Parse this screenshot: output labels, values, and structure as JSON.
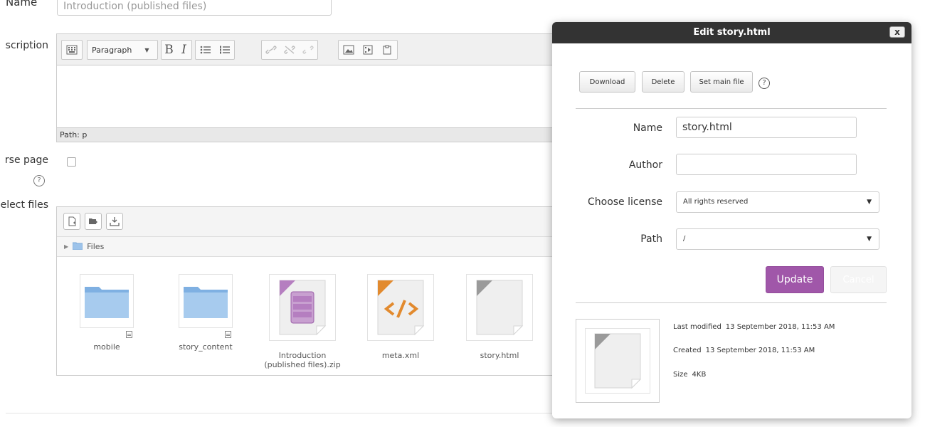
{
  "form": {
    "name_label": "Name",
    "name_value": "Introduction (published files)",
    "description_label": "scription",
    "course_page_label": "rse page",
    "select_files_label": "elect files",
    "help_glyph": "?"
  },
  "editor": {
    "paragraph_label": "Paragraph",
    "bold": "B",
    "italic": "I",
    "path_text": "Path: p"
  },
  "file_manager": {
    "path_label": "Files",
    "items": [
      {
        "label": "mobile",
        "type": "folder"
      },
      {
        "label": "story_content",
        "type": "folder"
      },
      {
        "label": "Introduction (published files).zip",
        "type": "zip"
      },
      {
        "label": "meta.xml",
        "type": "xml"
      },
      {
        "label": "story.html",
        "type": "file"
      }
    ]
  },
  "modal": {
    "title": "Edit story.html",
    "close": "x",
    "buttons": {
      "download": "Download",
      "delete": "Delete",
      "set_main_file": "Set main file",
      "update": "Update",
      "cancel": "Cancel"
    },
    "fields": {
      "name_label": "Name",
      "name_value": "story.html",
      "author_label": "Author",
      "author_value": "",
      "license_label": "Choose license",
      "license_value": "All rights reserved",
      "path_label": "Path",
      "path_value": "/"
    },
    "meta": {
      "last_modified_label": "Last modified",
      "last_modified_value": "13 September 2018, 11:53 AM",
      "created_label": "Created",
      "created_value": "13 September 2018, 11:53 AM",
      "size_label": "Size",
      "size_value": "4KB"
    }
  },
  "colors": {
    "accent": "#a057a9",
    "header": "#333333",
    "folder": "#9dc3ea",
    "zip": "#b57ec0",
    "xml": "#e28a2e"
  }
}
